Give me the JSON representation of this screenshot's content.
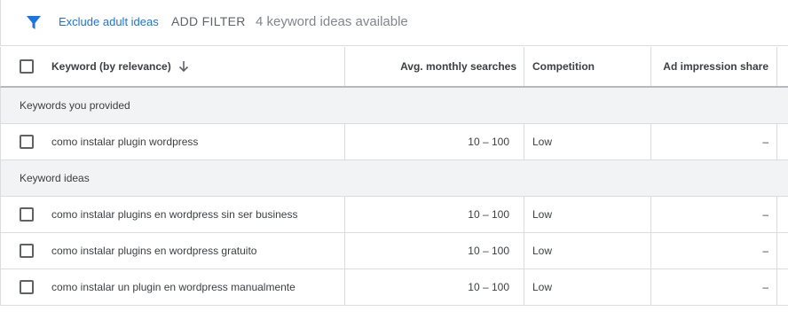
{
  "filter_bar": {
    "icon": "filter-icon",
    "exclude_label": "Exclude adult ideas",
    "add_filter_label": "ADD FILTER",
    "ideas_count_text": "4 keyword ideas available"
  },
  "table": {
    "columns": {
      "keyword": "Keyword (by relevance)",
      "avg_searches": "Avg. monthly searches",
      "competition": "Competition",
      "ad_share": "Ad impression share"
    },
    "groups": [
      {
        "label": "Keywords you provided",
        "rows": [
          {
            "keyword": "como instalar plugin wordpress",
            "avg": "10 – 100",
            "competition": "Low",
            "share": "–"
          }
        ]
      },
      {
        "label": "Keyword ideas",
        "rows": [
          {
            "keyword": "como instalar plugins en wordpress sin ser business",
            "avg": "10 – 100",
            "competition": "Low",
            "share": "–"
          },
          {
            "keyword": "como instalar plugins en wordpress gratuito",
            "avg": "10 – 100",
            "competition": "Low",
            "share": "–"
          },
          {
            "keyword": "como instalar un plugin en wordpress manualmente",
            "avg": "10 – 100",
            "competition": "Low",
            "share": "–"
          }
        ]
      }
    ]
  },
  "colors": {
    "accent": "#1a73e8",
    "group_bg": "#f1f3f4",
    "border": "#dadce0"
  }
}
